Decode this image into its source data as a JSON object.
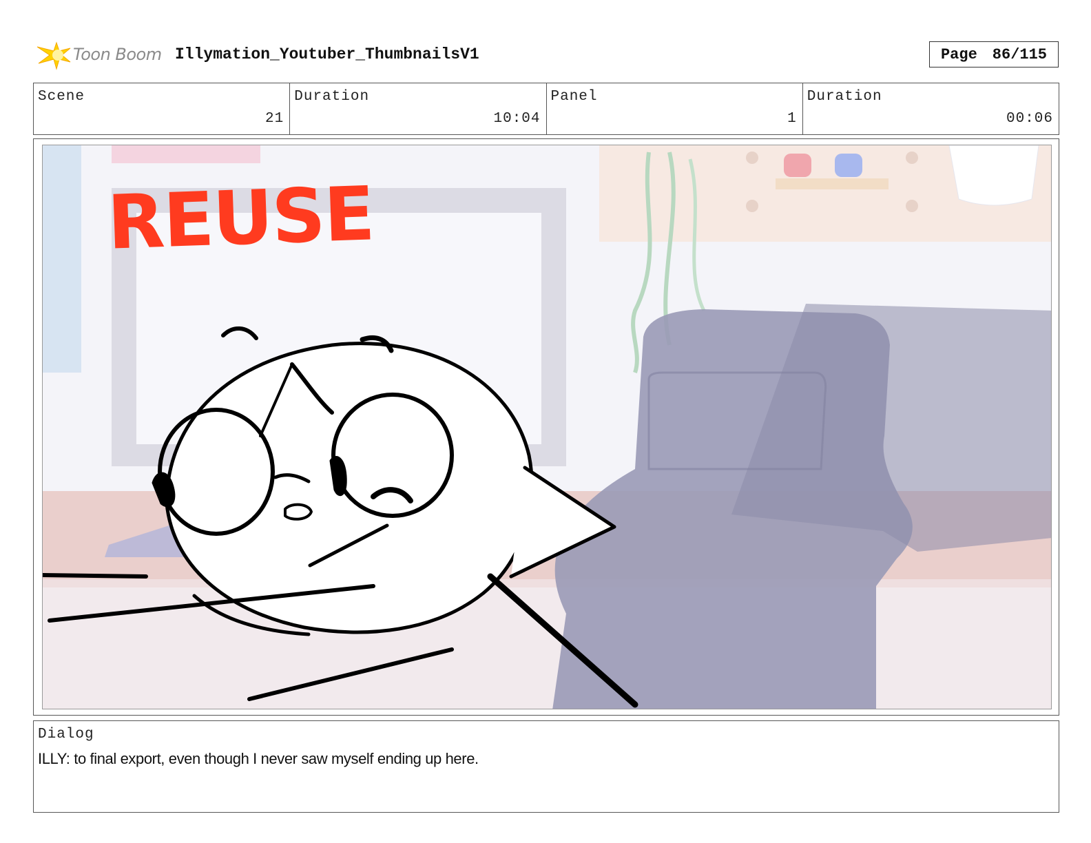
{
  "header": {
    "logo_text": "Toon Boom",
    "project_title": "Illymation_Youtuber_ThumbnailsV1",
    "page_label": "Page",
    "page_value": "86/115"
  },
  "info": {
    "scene_label": "Scene",
    "scene_value": "21",
    "scene_duration_label": "Duration",
    "scene_duration_value": "10:04",
    "panel_label": "Panel",
    "panel_value": "1",
    "panel_duration_label": "Duration",
    "panel_duration_value": "00:06"
  },
  "panel": {
    "stamp_text": "REUSE",
    "stamp_color": "#ff3b1f"
  },
  "dialog": {
    "label": "Dialog",
    "text": "ILLY: to final export, even though I never saw myself ending up here."
  }
}
